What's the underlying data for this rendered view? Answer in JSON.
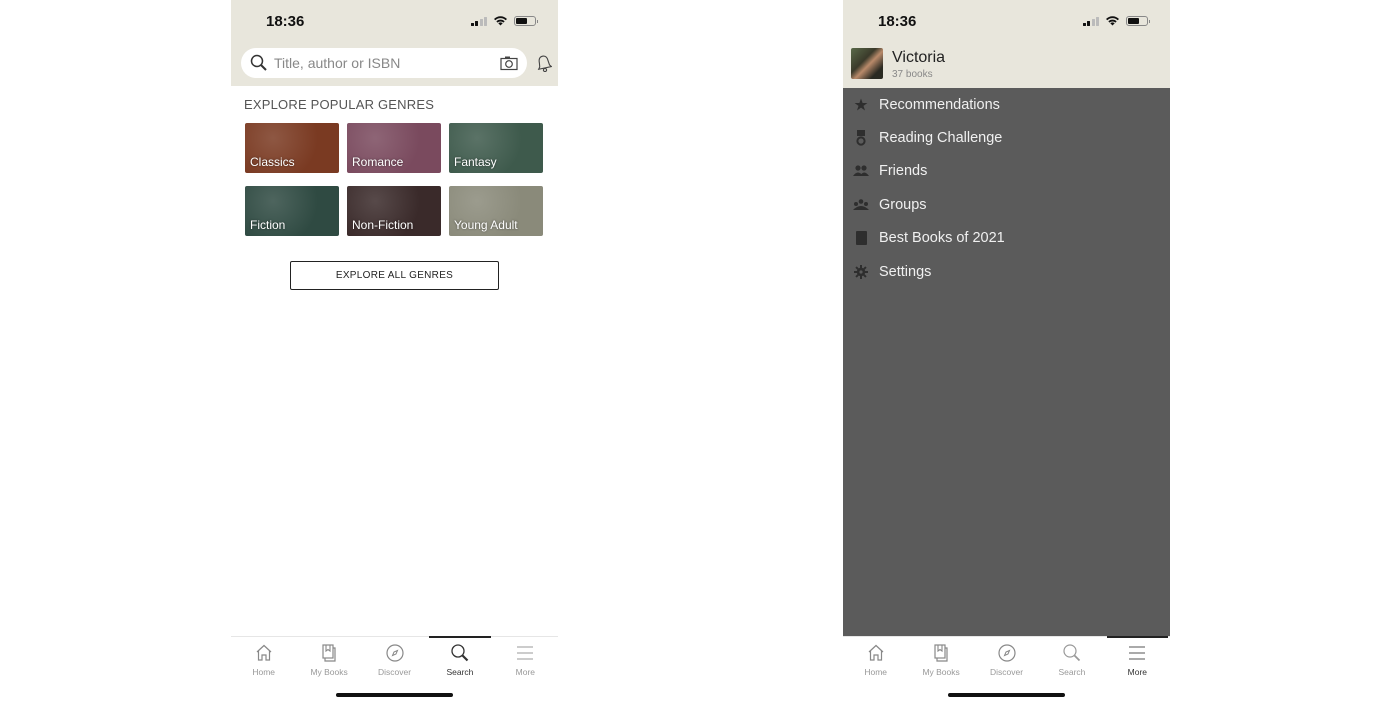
{
  "left_screen": {
    "status_bar": {
      "time": "18:36"
    },
    "search": {
      "placeholder": "Title, author or ISBN",
      "value": ""
    },
    "section_title": "EXPLORE POPULAR GENRES",
    "genres": [
      {
        "label": "Classics",
        "color": "#7a3a22"
      },
      {
        "label": "Romance",
        "color": "#7a4a5e"
      },
      {
        "label": "Fantasy",
        "color": "#3e5a4c"
      },
      {
        "label": "Fiction",
        "color": "#2f4a42"
      },
      {
        "label": "Non-Fiction",
        "color": "#3a2a2a"
      },
      {
        "label": "Young Adult",
        "color": "#8a8a7a"
      }
    ],
    "explore_all_label": "EXPLORE ALL GENRES",
    "tabs": [
      {
        "label": "Home",
        "icon": "home-icon"
      },
      {
        "label": "My Books",
        "icon": "my-books-icon"
      },
      {
        "label": "Discover",
        "icon": "compass-icon"
      },
      {
        "label": "Search",
        "icon": "search-icon"
      },
      {
        "label": "More",
        "icon": "menu-icon"
      }
    ],
    "active_tab": "Search"
  },
  "right_screen": {
    "status_bar": {
      "time": "18:36"
    },
    "profile": {
      "name": "Victoria",
      "book_count": "37 books"
    },
    "menu": [
      {
        "label": "Recommendations",
        "icon": "star-icon"
      },
      {
        "label": "Reading Challenge",
        "icon": "medal-icon"
      },
      {
        "label": "Friends",
        "icon": "friends-icon"
      },
      {
        "label": "Groups",
        "icon": "groups-icon"
      },
      {
        "label": "Best Books of 2021",
        "icon": "book-icon"
      },
      {
        "label": "Settings",
        "icon": "gear-icon"
      }
    ],
    "tabs": [
      {
        "label": "Home",
        "icon": "home-icon"
      },
      {
        "label": "My Books",
        "icon": "my-books-icon"
      },
      {
        "label": "Discover",
        "icon": "compass-icon"
      },
      {
        "label": "Search",
        "icon": "search-icon"
      },
      {
        "label": "More",
        "icon": "menu-icon"
      }
    ],
    "active_tab": "More"
  },
  "colors": {
    "header_bg": "#e8e6dc",
    "overlay_bg": "#5b5b5b",
    "menu_text": "#f0f0f0"
  }
}
